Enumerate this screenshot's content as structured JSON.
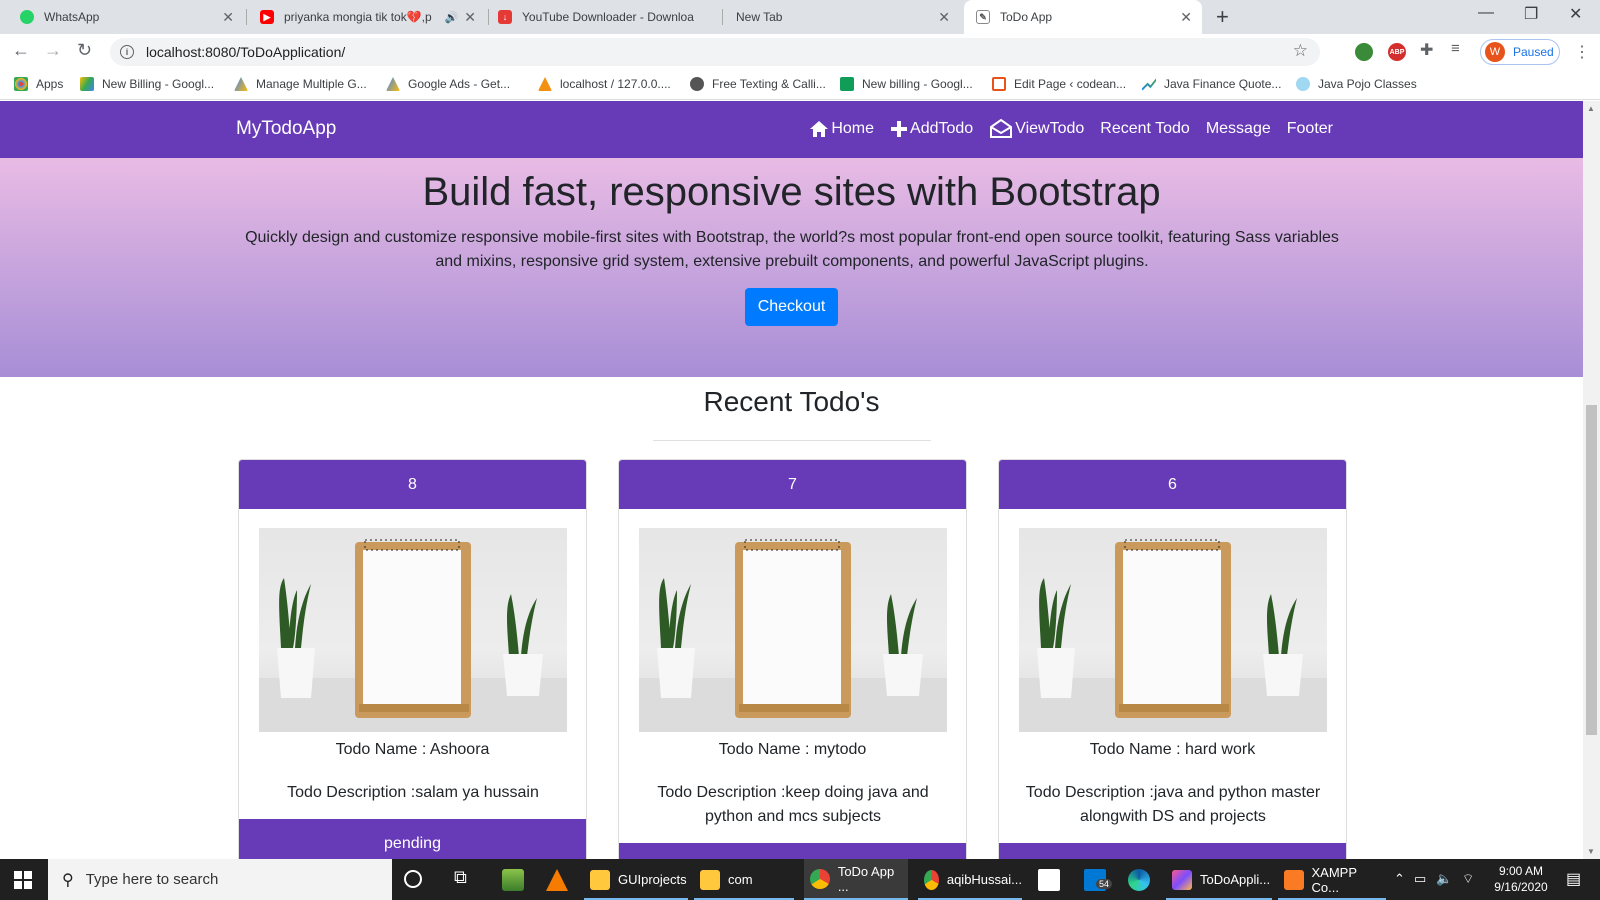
{
  "browser": {
    "tabs": [
      {
        "title": "WhatsApp"
      },
      {
        "title": "priyanka mongia tik tok💔,p"
      },
      {
        "title": "YouTube Downloader - Downloa"
      },
      {
        "title": "New Tab"
      },
      {
        "title": "ToDo App"
      }
    ],
    "url": "localhost:8080/ToDoApplication/",
    "profile_initial": "W",
    "profile_status": "Paused",
    "bookmarks": [
      {
        "label": "Apps"
      },
      {
        "label": "New Billing - Googl..."
      },
      {
        "label": "Manage Multiple G..."
      },
      {
        "label": "Google Ads - Get..."
      },
      {
        "label": "localhost / 127.0.0...."
      },
      {
        "label": "Free Texting & Calli..."
      },
      {
        "label": "New billing - Googl..."
      },
      {
        "label": "Edit Page ‹ codean..."
      },
      {
        "label": "Java Finance Quote..."
      },
      {
        "label": "Java Pojo Classes"
      }
    ]
  },
  "app": {
    "brand": "MyTodoApp",
    "nav": [
      {
        "label": "Home",
        "icon": "home-icon"
      },
      {
        "label": "AddTodo",
        "icon": "plus-icon"
      },
      {
        "label": "ViewTodo",
        "icon": "envelope-open-icon"
      },
      {
        "label": "Recent Todo",
        "icon": ""
      },
      {
        "label": "Message",
        "icon": ""
      },
      {
        "label": "Footer",
        "icon": ""
      }
    ],
    "hero": {
      "title": "Build fast, responsive sites with Bootstrap",
      "text": "Quickly design and customize responsive mobile-first sites with Bootstrap, the world?s most popular front-end open source toolkit, featuring Sass variables and mixins, responsive grid system, extensive prebuilt components, and powerful JavaScript plugins.",
      "button": "Checkout"
    },
    "section_title": "Recent Todo's",
    "cards": [
      {
        "id": "8",
        "name": "Todo Name : Ashoora",
        "description": "Todo Description :salam ya hussain",
        "status": "pending"
      },
      {
        "id": "7",
        "name": "Todo Name : mytodo",
        "description": "Todo Description :keep doing java and python and mcs subjects",
        "status": ""
      },
      {
        "id": "6",
        "name": "Todo Name : hard work",
        "description": "Todo Description :java and python master alongwith DS and projects",
        "status": ""
      }
    ],
    "colors": {
      "nav": "#673ab7",
      "button": "#007bff"
    }
  },
  "taskbar": {
    "search_placeholder": "Type here to search",
    "apps": [
      {
        "label": "GUIprojects"
      },
      {
        "label": "com"
      },
      {
        "label": "ToDo App ..."
      },
      {
        "label": "aqibHussai..."
      },
      {
        "label": "ToDoAppli..."
      },
      {
        "label": "XAMPP Co..."
      }
    ],
    "mail_badge": "54",
    "time": "9:00 AM",
    "date": "9/16/2020"
  }
}
